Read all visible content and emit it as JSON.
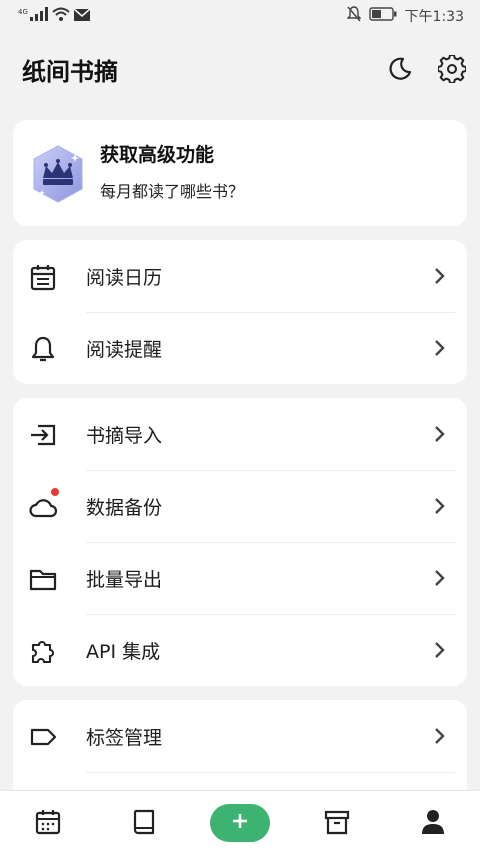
{
  "status_bar": {
    "network": "4G",
    "time": "下午1:33",
    "icons": [
      "signal-icon",
      "wifi-icon",
      "mail-icon",
      "bell-off-icon",
      "battery-icon"
    ]
  },
  "header": {
    "title": "纸间书摘",
    "icons": [
      "moon-icon",
      "gear-icon"
    ]
  },
  "premium": {
    "title": "获取高级功能",
    "subtitle": "每月都读了哪些书？",
    "icon": "crown-icon"
  },
  "groups": [
    {
      "items": [
        {
          "label": "阅读日历",
          "icon": "calendar-icon"
        },
        {
          "label": "阅读提醒",
          "icon": "bell-icon"
        }
      ]
    },
    {
      "items": [
        {
          "label": "书摘导入",
          "icon": "import-icon"
        },
        {
          "label": "数据备份",
          "icon": "cloud-icon"
        },
        {
          "label": "批量导出",
          "icon": "folder-icon"
        },
        {
          "label": "API 集成",
          "icon": "puzzle-icon"
        }
      ]
    },
    {
      "items": [
        {
          "label": "标签管理",
          "icon": "tag-icon"
        }
      ]
    }
  ],
  "bottom_nav": {
    "items": [
      "calendar-icon",
      "book-icon",
      "add-icon",
      "archive-icon",
      "profile-icon"
    ],
    "accent": "#3cb371"
  }
}
